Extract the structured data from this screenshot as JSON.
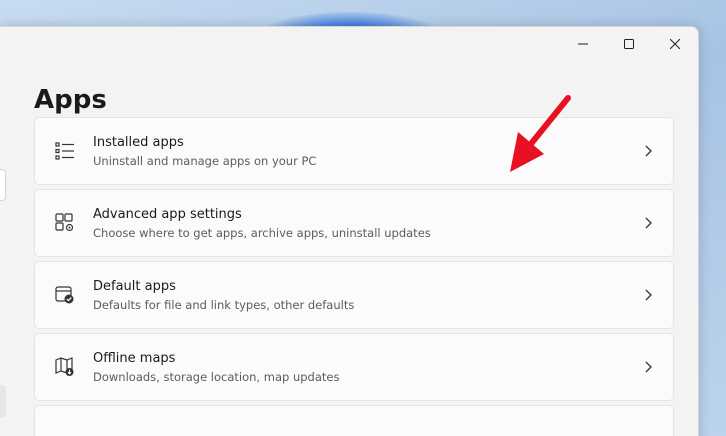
{
  "window": {
    "caption": {
      "minimize": "minimize-icon",
      "maximize": "maximize-icon",
      "close": "close-icon"
    }
  },
  "page": {
    "title": "Apps"
  },
  "items": [
    {
      "label": "Installed apps",
      "desc": "Uninstall and manage apps on your PC",
      "icon": "list-icon"
    },
    {
      "label": "Advanced app settings",
      "desc": "Choose where to get apps, archive apps, uninstall updates",
      "icon": "app-settings-icon"
    },
    {
      "label": "Default apps",
      "desc": "Defaults for file and link types, other defaults",
      "icon": "default-apps-icon"
    },
    {
      "label": "Offline maps",
      "desc": "Downloads, storage location, map updates",
      "icon": "map-icon"
    }
  ],
  "annotation": {
    "arrow_color": "#e81123",
    "icon": "red-arrow-icon"
  },
  "colors": {
    "background": "#f3f3f3",
    "card": "#fbfbfb",
    "text": "#1a1a1a",
    "secondary_text": "#5c5c5c"
  }
}
